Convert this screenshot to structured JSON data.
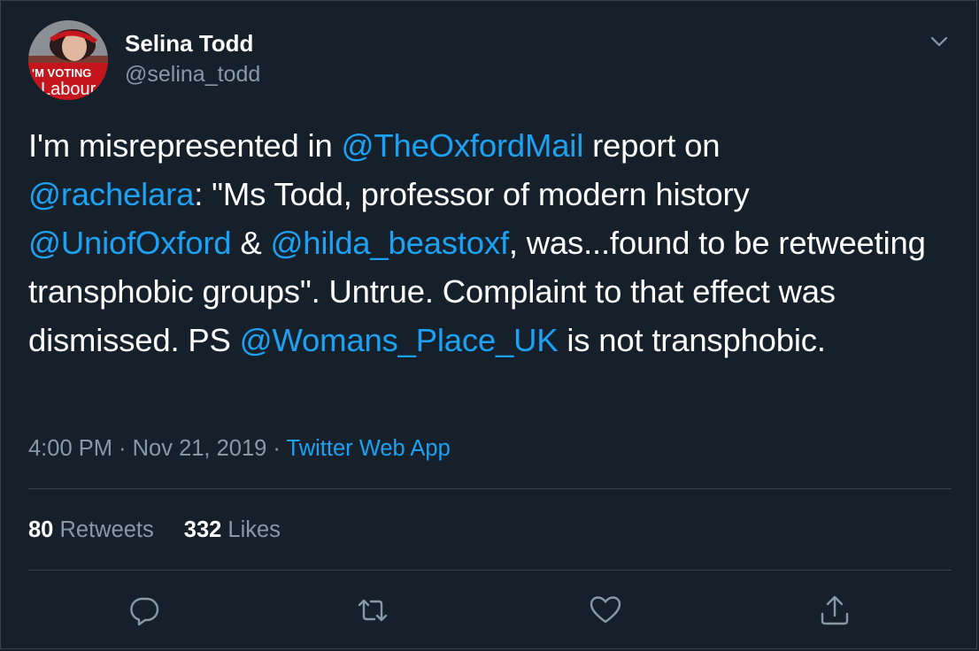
{
  "author": {
    "name": "Selina Todd",
    "handle": "@selina_todd",
    "avatar_text_top": "'M VOTING",
    "avatar_text_bottom": "Labour"
  },
  "tweet": {
    "segments": [
      {
        "text": "I'm misrepresented in ",
        "type": "text"
      },
      {
        "text": "@TheOxfordMail",
        "type": "mention"
      },
      {
        "text": " report on ",
        "type": "text"
      },
      {
        "text": "@rachelara",
        "type": "mention"
      },
      {
        "text": ": \"Ms Todd, professor of modern history ",
        "type": "text"
      },
      {
        "text": "@UniofOxford",
        "type": "mention"
      },
      {
        "text": " & ",
        "type": "text"
      },
      {
        "text": "@hilda_beastoxf",
        "type": "mention"
      },
      {
        "text": ", was...found to be retweeting transphobic groups\". Untrue. Complaint to that effect was dismissed. PS ",
        "type": "text"
      },
      {
        "text": "@Womans_Place_UK",
        "type": "mention"
      },
      {
        "text": " is not transphobic.",
        "type": "text"
      }
    ]
  },
  "meta": {
    "time": "4:00 PM",
    "separator": " · ",
    "date": "Nov 21, 2019",
    "source": "Twitter Web App"
  },
  "stats": {
    "retweets_count": "80",
    "retweets_label": "Retweets",
    "likes_count": "332",
    "likes_label": "Likes"
  },
  "actions": {
    "reply_icon": "reply-icon",
    "retweet_icon": "retweet-icon",
    "like_icon": "heart-icon",
    "share_icon": "share-icon"
  },
  "colors": {
    "background": "#15202b",
    "accent": "#1da1f2",
    "secondary_text": "#8899a6",
    "divider": "#38444d"
  }
}
